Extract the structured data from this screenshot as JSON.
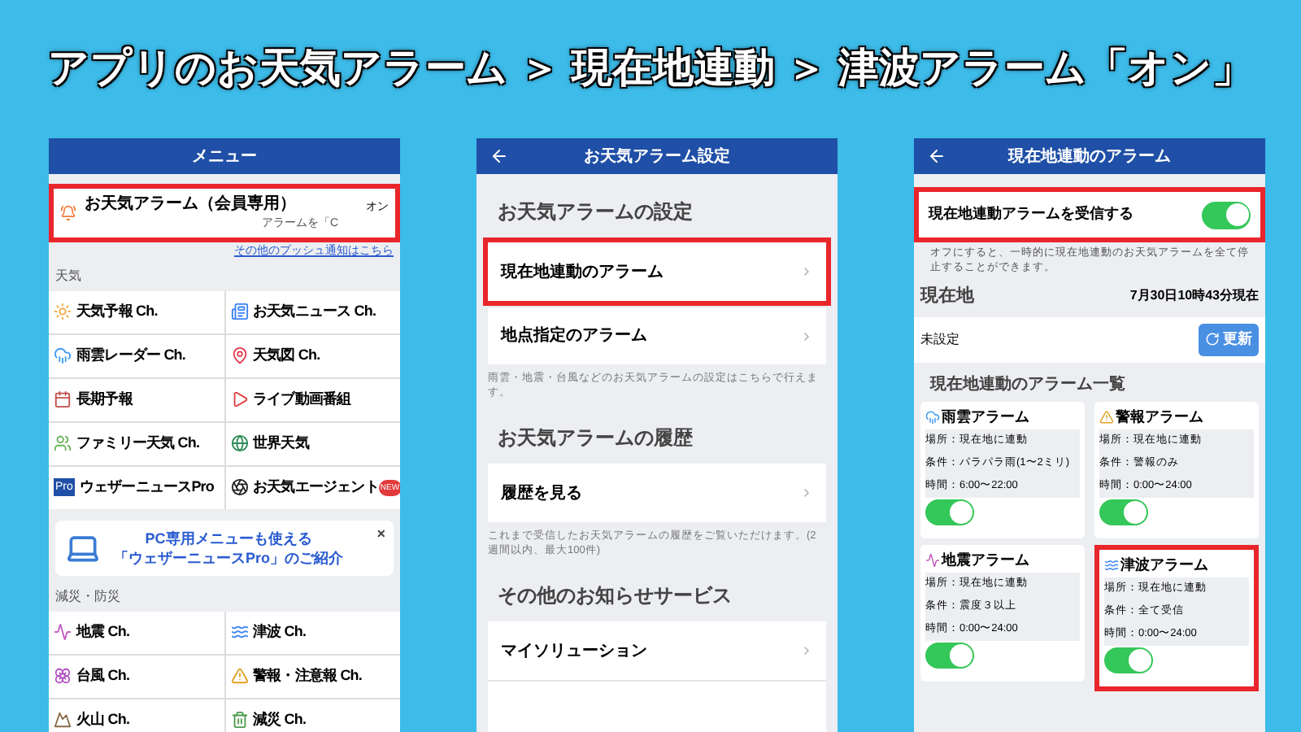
{
  "headline": "アプリのお天気アラーム ＞ 現在地連動 ＞ 津波アラーム「オン」",
  "menu_screen": {
    "title": "メニュー",
    "alarm_item": {
      "label": "お天気アラーム（会員専用）",
      "status": "オン",
      "sub": "アラームを「C",
      "highlighted": true
    },
    "push_link": "その他のプッシュ通知はこちら",
    "weather_section": "天気",
    "weather_items": [
      {
        "label": "天気予報 Ch."
      },
      {
        "label": "お天気ニュース Ch."
      },
      {
        "label": "雨雲レーダー Ch."
      },
      {
        "label": "天気図 Ch."
      },
      {
        "label": "長期予報"
      },
      {
        "label": "ライブ動画番組"
      },
      {
        "label": "ファミリー天気 Ch."
      },
      {
        "label": "世界天気"
      },
      {
        "label": "ウェザーニュースPro",
        "icon_text": "Pro"
      },
      {
        "label": "お天気エージェント",
        "badge": "NEW"
      }
    ],
    "promo": {
      "line1": "PC専用メニューも使える",
      "line2": "「ウェザーニュースPro」のご紹介",
      "close": "×"
    },
    "disaster_section": "減災・防災",
    "disaster_items": [
      {
        "label": "地震 Ch."
      },
      {
        "label": "津波 Ch."
      },
      {
        "label": "台風 Ch."
      },
      {
        "label": "警報・注意報 Ch."
      },
      {
        "label": "火山 Ch."
      },
      {
        "label": "減災 Ch."
      }
    ]
  },
  "settings_screen": {
    "title": "お天気アラーム設定",
    "sections": [
      {
        "heading": "お天気アラームの設定",
        "rows": [
          {
            "label": "現在地連動のアラーム",
            "highlighted": true
          },
          {
            "label": "地点指定のアラーム",
            "highlighted": false
          }
        ],
        "note": "雨雲・地震・台風などのお天気アラームの設定はこちらで行えます。"
      },
      {
        "heading": "お天気アラームの履歴",
        "rows": [
          {
            "label": "履歴を見る",
            "highlighted": false
          }
        ],
        "note": "これまで受信したお天気アラームの履歴をご覧いただけます。(2週間以内、最大100件)"
      },
      {
        "heading": "その他のお知らせサービス",
        "rows": [
          {
            "label": "マイソリューション",
            "highlighted": false
          },
          {
            "label": "",
            "highlighted": false
          }
        ]
      }
    ]
  },
  "location_screen": {
    "title": "現在地連動のアラーム",
    "receive": {
      "label": "現在地連動アラームを受信する",
      "on": true,
      "highlighted": true
    },
    "receive_note": "オフにすると、一時的に現在地連動のお天気アラームを全て停止することができます。",
    "location_label": "現在地",
    "timestamp": "7月30日10時43分現在",
    "location_value": "未設定",
    "refresh_button": "更新",
    "list_title": "現在地連動のアラーム一覧",
    "alarms": [
      {
        "title": "雨雲アラーム",
        "place": "場所：現在地に連動",
        "condition": "条件：パラパラ雨(1〜2ミリ)",
        "time": "時間：6:00〜22:00",
        "on": true,
        "highlighted": false
      },
      {
        "title": "警報アラーム",
        "place": "場所：現在地に連動",
        "condition": "条件：警報のみ",
        "time": "時間：0:00〜24:00",
        "on": true,
        "highlighted": false
      },
      {
        "title": "地震アラーム",
        "place": "場所：現在地に連動",
        "condition": "条件：震度３以上",
        "time": "時間：0:00〜24:00",
        "on": true,
        "highlighted": false
      },
      {
        "title": "津波アラーム",
        "place": "場所：現在地に連動",
        "condition": "条件：全て受信",
        "time": "時間：0:00〜24:00",
        "on": true,
        "highlighted": true
      }
    ]
  }
}
